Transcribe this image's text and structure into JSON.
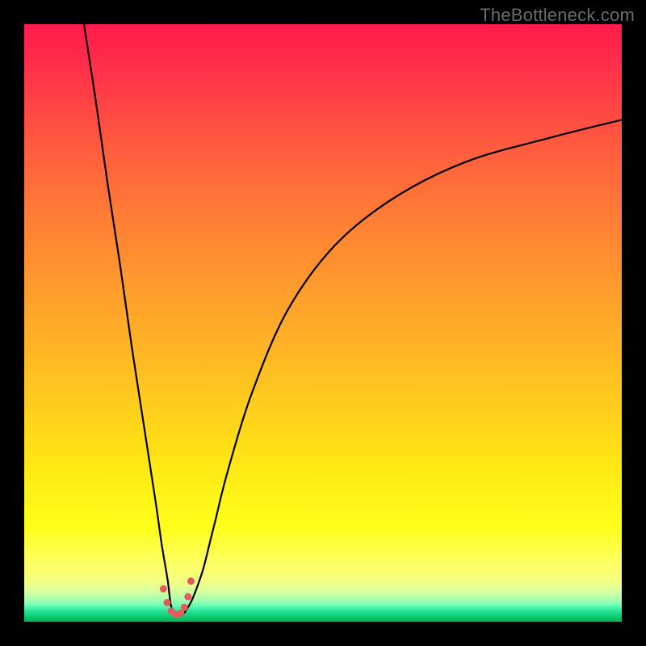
{
  "watermark": "TheBottleneck.com",
  "chart_data": {
    "type": "line",
    "title": "",
    "xlabel": "",
    "ylabel": "",
    "xlim": [
      0,
      100
    ],
    "ylim": [
      0,
      100
    ],
    "grid": false,
    "series": [
      {
        "name": "bottleneck-curve",
        "x": [
          10,
          12,
          14,
          16,
          18,
          20,
          22,
          23,
          24,
          24.5,
          25,
          25.5,
          26,
          26.5,
          27,
          28,
          29,
          30,
          31,
          32,
          34,
          38,
          44,
          52,
          62,
          74,
          88,
          100
        ],
        "y": [
          100,
          87,
          73,
          60,
          46,
          33,
          20,
          13,
          7,
          3,
          1.5,
          1,
          1,
          1.2,
          1.8,
          3.5,
          6,
          9,
          13,
          17,
          25,
          38,
          52,
          63,
          71,
          77,
          81,
          84
        ]
      }
    ],
    "markers": {
      "x": [
        23.3,
        23.9,
        24.6,
        25.4,
        26.2,
        26.8,
        27.4,
        27.9
      ],
      "y": [
        5.5,
        3.2,
        1.8,
        1.2,
        1.4,
        2.4,
        4.2,
        6.8
      ],
      "color": "#e55a5a",
      "size": 9
    }
  }
}
